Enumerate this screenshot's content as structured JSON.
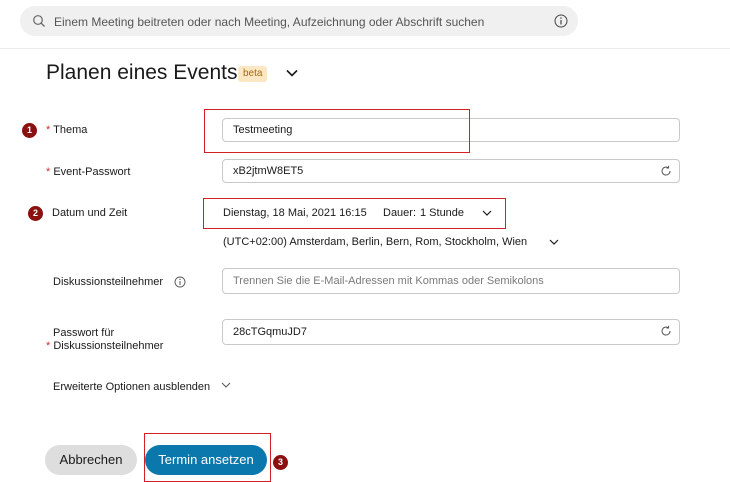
{
  "search": {
    "placeholder": "Einem Meeting beitreten oder nach Meeting, Aufzeichnung oder Abschrift suchen",
    "search_icon": "search-icon",
    "info_icon": "info-icon"
  },
  "header": {
    "title": "Planen eines Events",
    "badge": "beta",
    "chevron_icon": "chevron-down-icon"
  },
  "steps": [
    "1",
    "2",
    "3"
  ],
  "form": {
    "topic": {
      "label": "Thema",
      "required": "*",
      "value": "Testmeeting"
    },
    "event_password": {
      "label": "Event-Passwort",
      "required": "*",
      "value": "xB2jtmW8ET5",
      "refresh_icon": "refresh-icon"
    },
    "datetime": {
      "label": "Datum und Zeit",
      "value": "Dienstag, 18 Mai, 2021 16:15",
      "duration_label": "Dauer:",
      "duration_value": "1 Stunde",
      "timezone": "(UTC+02:00) Amsterdam, Berlin, Bern, Rom, Stockholm, Wien"
    },
    "panelists": {
      "label": "Diskussionsteilnehmer",
      "placeholder": "Trennen Sie die E-Mail-Adressen mit Kommas oder Semikolons",
      "info_icon": "info-icon"
    },
    "panelist_password": {
      "label_line1": "Passwort für",
      "label_line2": "Diskussionsteilnehmer",
      "required": "*",
      "value": "28cTGqmuJD7",
      "refresh_icon": "refresh-icon"
    },
    "advanced_toggle": "Erweiterte Optionen ausblenden"
  },
  "buttons": {
    "cancel": "Abbrechen",
    "schedule": "Termin ansetzen"
  },
  "colors": {
    "accent": "#0b78ad",
    "highlight": "#d31f26",
    "step_badge": "#8b1111",
    "beta_badge_bg": "#fbe7c3"
  }
}
